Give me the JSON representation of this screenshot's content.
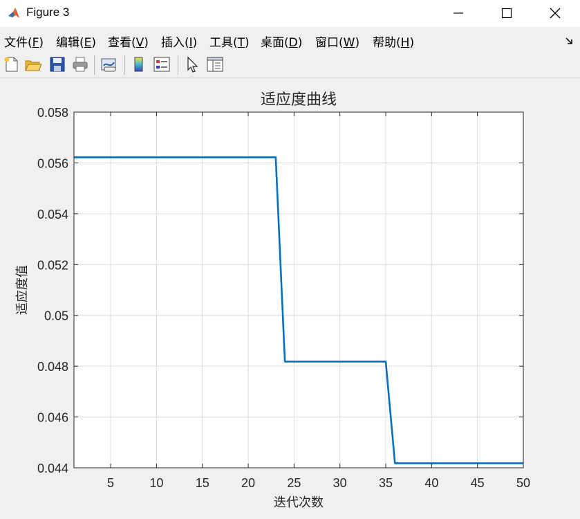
{
  "window": {
    "title": "Figure 3",
    "icon": "matlab-icon"
  },
  "menu": [
    {
      "label": "文件(",
      "key": "F",
      "tail": ")"
    },
    {
      "label": "编辑(",
      "key": "E",
      "tail": ")"
    },
    {
      "label": "查看(",
      "key": "V",
      "tail": ")"
    },
    {
      "label": "插入(",
      "key": "I",
      "tail": ")"
    },
    {
      "label": "工具(",
      "key": "T",
      "tail": ")"
    },
    {
      "label": "桌面(",
      "key": "D",
      "tail": ")"
    },
    {
      "label": "窗口(",
      "key": "W",
      "tail": ")"
    },
    {
      "label": "帮助(",
      "key": "H",
      "tail": ")"
    }
  ],
  "toolbar": [
    "new-figure-icon",
    "open-file-icon",
    "save-icon",
    "print-icon",
    "link-plot-icon",
    "colorbar-icon",
    "legend-icon",
    "pointer-icon",
    "property-editor-icon"
  ],
  "colors": {
    "line": "#0072bd",
    "grid": "#dcdcdc",
    "axes": "#262626"
  },
  "chart_data": {
    "type": "line",
    "title": "适应度曲线",
    "xlabel": "迭代次数",
    "ylabel": "适应度值",
    "xlim": [
      1,
      50
    ],
    "ylim": [
      0.044,
      0.058
    ],
    "xticks": [
      5,
      10,
      15,
      20,
      25,
      30,
      35,
      40,
      45,
      50
    ],
    "yticks": [
      0.044,
      0.046,
      0.048,
      0.05,
      0.052,
      0.054,
      0.056,
      0.058
    ],
    "ytick_labels": [
      "0.044",
      "0.046",
      "0.048",
      "0.05",
      "0.052",
      "0.054",
      "0.056",
      "0.058"
    ],
    "grid": true,
    "series": [
      {
        "x": [
          1,
          23,
          24,
          35,
          36,
          50
        ],
        "y": [
          0.05622,
          0.05622,
          0.04818,
          0.04818,
          0.04418,
          0.04418
        ]
      }
    ]
  }
}
